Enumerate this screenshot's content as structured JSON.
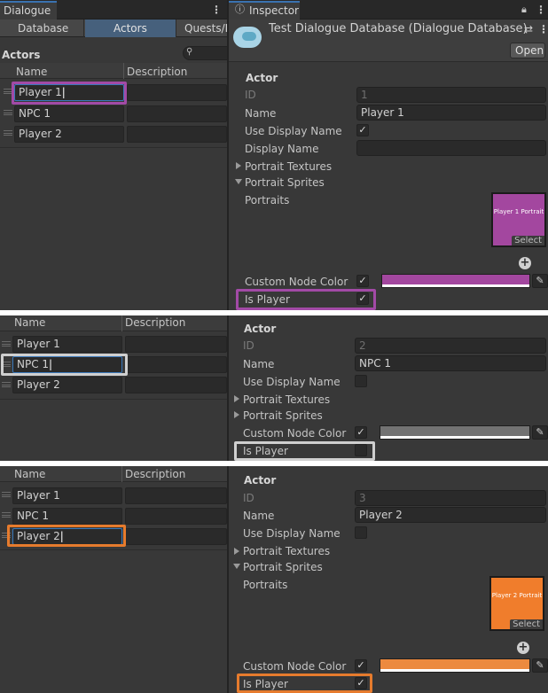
{
  "top": {
    "dialogue_tab": "Dialogue",
    "inspector_tab": "Inspector",
    "db_title": "Test Dialogue Database (Dialogue Database)",
    "open_button": "Open",
    "subtabs": [
      "Database",
      "Actors",
      "Quests/I"
    ],
    "actors_heading": "Actors",
    "columns": {
      "name": "Name",
      "description": "Description"
    },
    "rows": [
      {
        "name": "Player 1"
      },
      {
        "name": "NPC 1"
      },
      {
        "name": "Player 2"
      }
    ],
    "inspector": {
      "section": "Actor",
      "id_label": "ID",
      "id_value": "1",
      "name_label": "Name",
      "name_value": "Player 1",
      "use_display_name_label": "Use Display Name",
      "use_display_name_check": "✓",
      "display_name_label": "Display Name",
      "display_name_value": "",
      "portrait_textures_label": "Portrait Textures",
      "portrait_sprites_label": "Portrait Sprites",
      "portraits_label": "Portraits",
      "portrait_text": "Player 1 Portrait",
      "select_label": "Select",
      "custom_node_color_label": "Custom Node Color",
      "custom_node_color_check": "✓",
      "node_color": "#a3479f",
      "is_player_label": "Is Player",
      "is_player_check": "✓",
      "highlight": "#a24aa6"
    }
  },
  "middle": {
    "columns": {
      "name": "Name",
      "description": "Description"
    },
    "rows": [
      {
        "name": "Player 1"
      },
      {
        "name": "NPC 1"
      },
      {
        "name": "Player 2"
      }
    ],
    "inspector": {
      "section": "Actor",
      "id_label": "ID",
      "id_value": "2",
      "name_label": "Name",
      "name_value": "NPC 1",
      "use_display_name_label": "Use Display Name",
      "portrait_textures_label": "Portrait Textures",
      "portrait_sprites_label": "Portrait Sprites",
      "custom_node_color_label": "Custom Node Color",
      "custom_node_color_check": "✓",
      "node_color": "#727272",
      "is_player_label": "Is Player",
      "highlight": "#cfcfcf"
    }
  },
  "bottom": {
    "columns": {
      "name": "Name",
      "description": "Description"
    },
    "rows": [
      {
        "name": "Player 1"
      },
      {
        "name": "NPC 1"
      },
      {
        "name": "Player 2"
      }
    ],
    "inspector": {
      "section": "Actor",
      "id_label": "ID",
      "id_value": "3",
      "name_label": "Name",
      "name_value": "Player 2",
      "use_display_name_label": "Use Display Name",
      "portrait_textures_label": "Portrait Textures",
      "portrait_sprites_label": "Portrait Sprites",
      "portraits_label": "Portraits",
      "portrait_text": "Player 2 Portrait",
      "select_label": "Select",
      "custom_node_color_label": "Custom Node Color",
      "custom_node_color_check": "✓",
      "node_color": "#ec8a3f",
      "is_player_label": "Is Player",
      "is_player_check": "✓",
      "highlight": "#e67b2d"
    }
  }
}
